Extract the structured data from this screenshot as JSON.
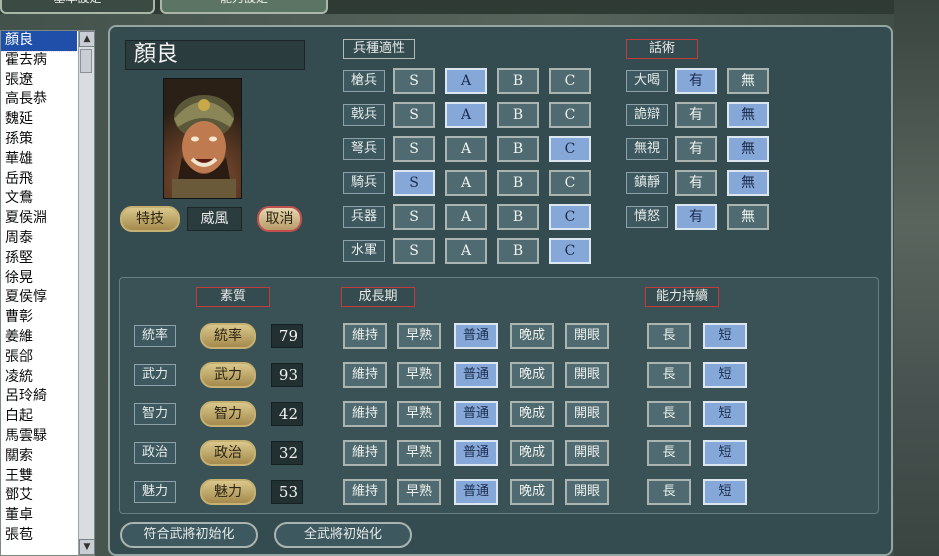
{
  "top_tabs": [
    "基本設定",
    "能力設定"
  ],
  "sidebar": {
    "items": [
      "顏良",
      "霍去病",
      "張遼",
      "高長恭",
      "魏延",
      "孫策",
      "華雄",
      "岳飛",
      "文鴦",
      "夏侯淵",
      "周泰",
      "孫堅",
      "徐晃",
      "夏侯惇",
      "曹彰",
      "姜維",
      "張郃",
      "凌統",
      "呂玲綺",
      "白起",
      "馬雲騄",
      "關索",
      "王雙",
      "鄧艾",
      "董卓",
      "張苞"
    ],
    "selected": 0
  },
  "general": {
    "name": "顏良",
    "skill_button": "特技",
    "skill_value": "威風",
    "cancel_button": "取消"
  },
  "aptitude": {
    "header": "兵種適性",
    "grades": [
      "S",
      "A",
      "B",
      "C"
    ],
    "rows": [
      {
        "label": "槍兵",
        "selected": "A"
      },
      {
        "label": "戟兵",
        "selected": "A"
      },
      {
        "label": "弩兵",
        "selected": "C"
      },
      {
        "label": "騎兵",
        "selected": "S"
      },
      {
        "label": "兵器",
        "selected": "C"
      },
      {
        "label": "水軍",
        "selected": "C"
      }
    ]
  },
  "tactics": {
    "header": "話術",
    "yes": "有",
    "no": "無",
    "rows": [
      {
        "label": "大喝",
        "selected": "有"
      },
      {
        "label": "詭辯",
        "selected": "無"
      },
      {
        "label": "無視",
        "selected": "無"
      },
      {
        "label": "鎮靜",
        "selected": "無"
      },
      {
        "label": "憤怒",
        "selected": "有"
      }
    ]
  },
  "stats": {
    "aptitude_header": "素質",
    "growth_header": "成長期",
    "duration_header": "能力持續",
    "growth_options": [
      "維持",
      "早熟",
      "普通",
      "晚成",
      "開眼"
    ],
    "duration_options": [
      "長",
      "短"
    ],
    "rows": [
      {
        "label": "統率",
        "button": "統率",
        "value": "79",
        "growth": "普通",
        "duration": "短"
      },
      {
        "label": "武力",
        "button": "武力",
        "value": "93",
        "growth": "普通",
        "duration": "短"
      },
      {
        "label": "智力",
        "button": "智力",
        "value": "42",
        "growth": "普通",
        "duration": "短"
      },
      {
        "label": "政治",
        "button": "政治",
        "value": "32",
        "growth": "普通",
        "duration": "短"
      },
      {
        "label": "魅力",
        "button": "魅力",
        "value": "53",
        "growth": "普通",
        "duration": "短"
      }
    ]
  },
  "footer": {
    "reset_match": "符合武將初始化",
    "reset_all": "全武將初始化"
  }
}
